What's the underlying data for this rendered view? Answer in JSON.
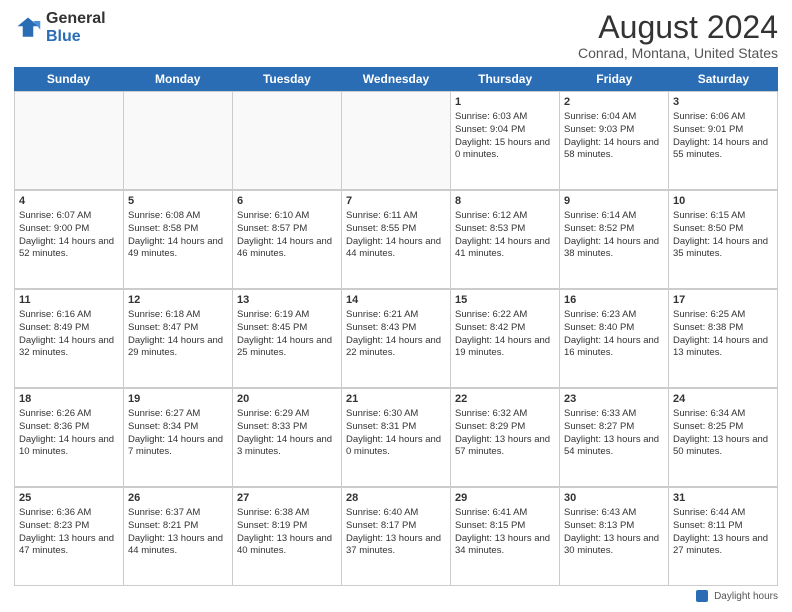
{
  "header": {
    "logo_general": "General",
    "logo_blue": "Blue",
    "title": "August 2024",
    "subtitle": "Conrad, Montana, United States"
  },
  "calendar": {
    "days_of_week": [
      "Sunday",
      "Monday",
      "Tuesday",
      "Wednesday",
      "Thursday",
      "Friday",
      "Saturday"
    ],
    "legend_label": "Daylight hours",
    "rows": [
      {
        "cells": [
          {
            "day": "",
            "empty": true
          },
          {
            "day": "",
            "empty": true
          },
          {
            "day": "",
            "empty": true
          },
          {
            "day": "",
            "empty": true
          },
          {
            "day": "1",
            "sunrise": "Sunrise: 6:03 AM",
            "sunset": "Sunset: 9:04 PM",
            "daylight": "Daylight: 15 hours and 0 minutes."
          },
          {
            "day": "2",
            "sunrise": "Sunrise: 6:04 AM",
            "sunset": "Sunset: 9:03 PM",
            "daylight": "Daylight: 14 hours and 58 minutes."
          },
          {
            "day": "3",
            "sunrise": "Sunrise: 6:06 AM",
            "sunset": "Sunset: 9:01 PM",
            "daylight": "Daylight: 14 hours and 55 minutes."
          }
        ]
      },
      {
        "cells": [
          {
            "day": "4",
            "sunrise": "Sunrise: 6:07 AM",
            "sunset": "Sunset: 9:00 PM",
            "daylight": "Daylight: 14 hours and 52 minutes."
          },
          {
            "day": "5",
            "sunrise": "Sunrise: 6:08 AM",
            "sunset": "Sunset: 8:58 PM",
            "daylight": "Daylight: 14 hours and 49 minutes."
          },
          {
            "day": "6",
            "sunrise": "Sunrise: 6:10 AM",
            "sunset": "Sunset: 8:57 PM",
            "daylight": "Daylight: 14 hours and 46 minutes."
          },
          {
            "day": "7",
            "sunrise": "Sunrise: 6:11 AM",
            "sunset": "Sunset: 8:55 PM",
            "daylight": "Daylight: 14 hours and 44 minutes."
          },
          {
            "day": "8",
            "sunrise": "Sunrise: 6:12 AM",
            "sunset": "Sunset: 8:53 PM",
            "daylight": "Daylight: 14 hours and 41 minutes."
          },
          {
            "day": "9",
            "sunrise": "Sunrise: 6:14 AM",
            "sunset": "Sunset: 8:52 PM",
            "daylight": "Daylight: 14 hours and 38 minutes."
          },
          {
            "day": "10",
            "sunrise": "Sunrise: 6:15 AM",
            "sunset": "Sunset: 8:50 PM",
            "daylight": "Daylight: 14 hours and 35 minutes."
          }
        ]
      },
      {
        "cells": [
          {
            "day": "11",
            "sunrise": "Sunrise: 6:16 AM",
            "sunset": "Sunset: 8:49 PM",
            "daylight": "Daylight: 14 hours and 32 minutes."
          },
          {
            "day": "12",
            "sunrise": "Sunrise: 6:18 AM",
            "sunset": "Sunset: 8:47 PM",
            "daylight": "Daylight: 14 hours and 29 minutes."
          },
          {
            "day": "13",
            "sunrise": "Sunrise: 6:19 AM",
            "sunset": "Sunset: 8:45 PM",
            "daylight": "Daylight: 14 hours and 25 minutes."
          },
          {
            "day": "14",
            "sunrise": "Sunrise: 6:21 AM",
            "sunset": "Sunset: 8:43 PM",
            "daylight": "Daylight: 14 hours and 22 minutes."
          },
          {
            "day": "15",
            "sunrise": "Sunrise: 6:22 AM",
            "sunset": "Sunset: 8:42 PM",
            "daylight": "Daylight: 14 hours and 19 minutes."
          },
          {
            "day": "16",
            "sunrise": "Sunrise: 6:23 AM",
            "sunset": "Sunset: 8:40 PM",
            "daylight": "Daylight: 14 hours and 16 minutes."
          },
          {
            "day": "17",
            "sunrise": "Sunrise: 6:25 AM",
            "sunset": "Sunset: 8:38 PM",
            "daylight": "Daylight: 14 hours and 13 minutes."
          }
        ]
      },
      {
        "cells": [
          {
            "day": "18",
            "sunrise": "Sunrise: 6:26 AM",
            "sunset": "Sunset: 8:36 PM",
            "daylight": "Daylight: 14 hours and 10 minutes."
          },
          {
            "day": "19",
            "sunrise": "Sunrise: 6:27 AM",
            "sunset": "Sunset: 8:34 PM",
            "daylight": "Daylight: 14 hours and 7 minutes."
          },
          {
            "day": "20",
            "sunrise": "Sunrise: 6:29 AM",
            "sunset": "Sunset: 8:33 PM",
            "daylight": "Daylight: 14 hours and 3 minutes."
          },
          {
            "day": "21",
            "sunrise": "Sunrise: 6:30 AM",
            "sunset": "Sunset: 8:31 PM",
            "daylight": "Daylight: 14 hours and 0 minutes."
          },
          {
            "day": "22",
            "sunrise": "Sunrise: 6:32 AM",
            "sunset": "Sunset: 8:29 PM",
            "daylight": "Daylight: 13 hours and 57 minutes."
          },
          {
            "day": "23",
            "sunrise": "Sunrise: 6:33 AM",
            "sunset": "Sunset: 8:27 PM",
            "daylight": "Daylight: 13 hours and 54 minutes."
          },
          {
            "day": "24",
            "sunrise": "Sunrise: 6:34 AM",
            "sunset": "Sunset: 8:25 PM",
            "daylight": "Daylight: 13 hours and 50 minutes."
          }
        ]
      },
      {
        "cells": [
          {
            "day": "25",
            "sunrise": "Sunrise: 6:36 AM",
            "sunset": "Sunset: 8:23 PM",
            "daylight": "Daylight: 13 hours and 47 minutes."
          },
          {
            "day": "26",
            "sunrise": "Sunrise: 6:37 AM",
            "sunset": "Sunset: 8:21 PM",
            "daylight": "Daylight: 13 hours and 44 minutes."
          },
          {
            "day": "27",
            "sunrise": "Sunrise: 6:38 AM",
            "sunset": "Sunset: 8:19 PM",
            "daylight": "Daylight: 13 hours and 40 minutes."
          },
          {
            "day": "28",
            "sunrise": "Sunrise: 6:40 AM",
            "sunset": "Sunset: 8:17 PM",
            "daylight": "Daylight: 13 hours and 37 minutes."
          },
          {
            "day": "29",
            "sunrise": "Sunrise: 6:41 AM",
            "sunset": "Sunset: 8:15 PM",
            "daylight": "Daylight: 13 hours and 34 minutes."
          },
          {
            "day": "30",
            "sunrise": "Sunrise: 6:43 AM",
            "sunset": "Sunset: 8:13 PM",
            "daylight": "Daylight: 13 hours and 30 minutes."
          },
          {
            "day": "31",
            "sunrise": "Sunrise: 6:44 AM",
            "sunset": "Sunset: 8:11 PM",
            "daylight": "Daylight: 13 hours and 27 minutes."
          }
        ]
      }
    ]
  }
}
